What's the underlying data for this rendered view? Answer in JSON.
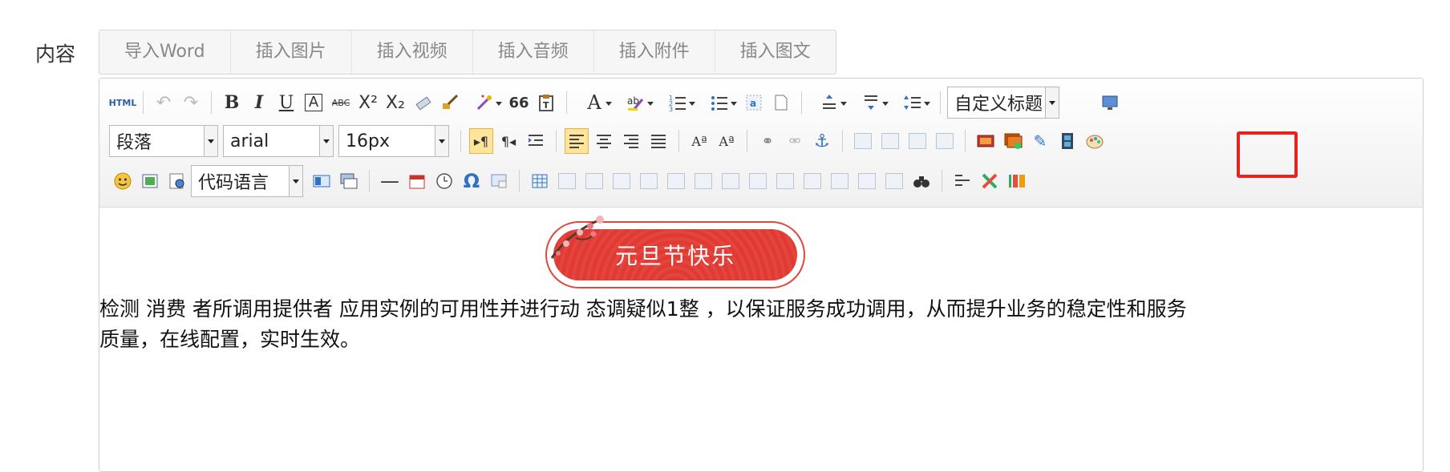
{
  "field_label": "内容",
  "insert_buttons": [
    "导入Word",
    "插入图片",
    "插入视频",
    "插入音频",
    "插入附件",
    "插入图文"
  ],
  "toolbar": {
    "html_label": "HTML",
    "quote_glyph": "66",
    "paragraph_select": "段落",
    "font_select": "arial",
    "size_select": "16px",
    "heading_select": "自定义标题",
    "code_select": "代码语言",
    "omega_glyph": "Ω"
  },
  "banner": {
    "text": "元旦节快乐"
  },
  "paragraph": "检测 消费 者所调用提供者 应用实例的可用性并进行动 态调疑似1整 ，以保证服务成功调用，从而提升业务的稳定性和服务质量，在线配置，实时生效。",
  "colors": {
    "highlight": "#e8231f",
    "banner": "#e03a32",
    "accent": "#2f71c6"
  }
}
